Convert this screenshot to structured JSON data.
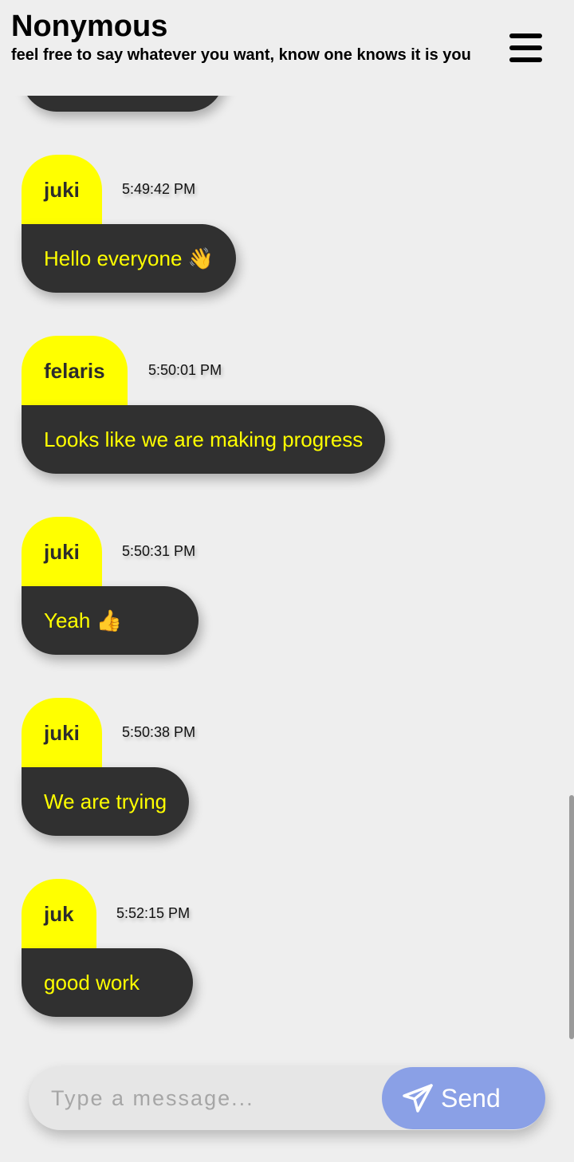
{
  "header": {
    "title": "Nonymous",
    "subtitle": "feel free to say whatever you want, know one knows it is you",
    "menu_icon": "hamburger-menu-icon"
  },
  "messages": [
    {
      "user": "juki",
      "time": "5:49:42 PM",
      "text": "Hello everyone 👋"
    },
    {
      "user": "felaris",
      "time": "5:50:01 PM",
      "text": "Looks like we are making progress"
    },
    {
      "user": "juki",
      "time": "5:50:31 PM",
      "text": "Yeah 👍"
    },
    {
      "user": "juki",
      "time": "5:50:38 PM",
      "text": "We are trying"
    },
    {
      "user": "juk",
      "time": "5:52:15 PM",
      "text": "good work"
    }
  ],
  "composer": {
    "placeholder": "Type a message...",
    "value": "",
    "send_label": "Send",
    "send_icon": "paper-plane-icon"
  },
  "colors": {
    "background": "#eeeeee",
    "username_tag": "#ffff00",
    "bubble": "#303030",
    "bubble_text": "#ffff00",
    "send_button": "#8aa0e6"
  }
}
